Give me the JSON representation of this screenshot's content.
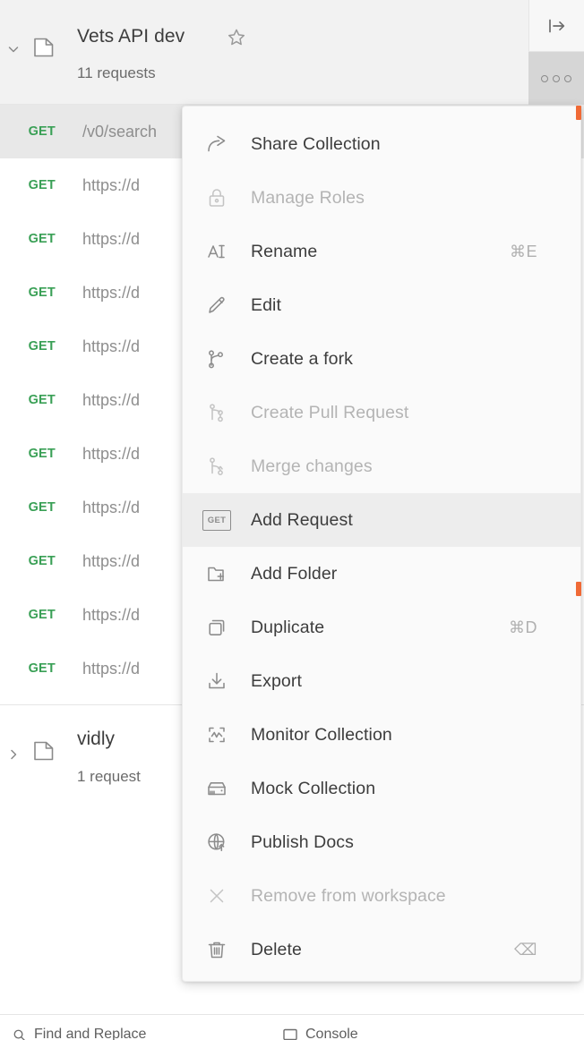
{
  "sidebar": {
    "collection": {
      "name": "Vets API dev",
      "request_count_label": "11 requests",
      "expanded": true,
      "favorite_icon": "star-icon",
      "collection_icon": "collection-icon",
      "chevron_icon": "chevron-down-icon"
    },
    "toolbar": {
      "collapse_pane_icon": "collapse-sidebar-icon",
      "more_actions_icon": "ellipsis-icon"
    },
    "requests": [
      {
        "method": "GET",
        "name": "/v0/search",
        "selected": true
      },
      {
        "method": "GET",
        "name": "https://d",
        "selected": false
      },
      {
        "method": "GET",
        "name": "https://d",
        "selected": false
      },
      {
        "method": "GET",
        "name": "https://d",
        "selected": false
      },
      {
        "method": "GET",
        "name": "https://d",
        "selected": false
      },
      {
        "method": "GET",
        "name": "https://d",
        "selected": false
      },
      {
        "method": "GET",
        "name": "https://d",
        "selected": false
      },
      {
        "method": "GET",
        "name": "https://d",
        "selected": false
      },
      {
        "method": "GET",
        "name": "https://d",
        "selected": false
      },
      {
        "method": "GET",
        "name": "https://d",
        "selected": false
      },
      {
        "method": "GET",
        "name": "https://d",
        "selected": false
      }
    ],
    "second_collection": {
      "name": "vidly",
      "request_count_label": "1 request",
      "expanded": false,
      "collection_icon": "collection-icon",
      "chevron_icon": "chevron-right-icon"
    }
  },
  "context_menu": {
    "items": [
      {
        "label": "Share Collection",
        "icon": "share-icon",
        "shortcut": "",
        "disabled": false,
        "hovered": false
      },
      {
        "label": "Manage Roles",
        "icon": "lock-icon",
        "shortcut": "",
        "disabled": true,
        "hovered": false
      },
      {
        "label": "Rename",
        "icon": "rename-text-icon",
        "shortcut": "⌘E",
        "disabled": false,
        "hovered": false
      },
      {
        "label": "Edit",
        "icon": "pencil-icon",
        "shortcut": "",
        "disabled": false,
        "hovered": false
      },
      {
        "label": "Create a fork",
        "icon": "fork-icon",
        "shortcut": "",
        "disabled": false,
        "hovered": false
      },
      {
        "label": "Create Pull Request",
        "icon": "pull-request-icon",
        "shortcut": "",
        "disabled": true,
        "hovered": false
      },
      {
        "label": "Merge changes",
        "icon": "merge-icon",
        "shortcut": "",
        "disabled": true,
        "hovered": false
      },
      {
        "label": "Add Request",
        "icon": "get-badge-icon",
        "shortcut": "",
        "disabled": false,
        "hovered": true
      },
      {
        "label": "Add Folder",
        "icon": "add-folder-icon",
        "shortcut": "",
        "disabled": false,
        "hovered": false
      },
      {
        "label": "Duplicate",
        "icon": "duplicate-icon",
        "shortcut": "⌘D",
        "disabled": false,
        "hovered": false
      },
      {
        "label": "Export",
        "icon": "download-icon",
        "shortcut": "",
        "disabled": false,
        "hovered": false
      },
      {
        "label": "Monitor Collection",
        "icon": "monitor-icon",
        "shortcut": "",
        "disabled": false,
        "hovered": false
      },
      {
        "label": "Mock Collection",
        "icon": "mock-server-icon",
        "shortcut": "",
        "disabled": false,
        "hovered": false
      },
      {
        "label": "Publish Docs",
        "icon": "globe-upload-icon",
        "shortcut": "",
        "disabled": false,
        "hovered": false
      },
      {
        "label": "Remove from workspace",
        "icon": "close-x-icon",
        "shortcut": "",
        "disabled": true,
        "hovered": false
      },
      {
        "label": "Delete",
        "icon": "trash-icon",
        "shortcut": "⌫",
        "disabled": false,
        "hovered": false
      }
    ],
    "get_badge_text": "GET"
  },
  "footer": {
    "find_replace_label": "Find and Replace",
    "console_label": "Console",
    "find_icon": "search-icon",
    "console_icon": "terminal-icon"
  },
  "colors": {
    "method_get": "#3aa056",
    "marker": "#f06a36",
    "menu_bg": "#fafafa",
    "hover_bg": "#ededed",
    "header_bg": "#f2f2f2"
  }
}
